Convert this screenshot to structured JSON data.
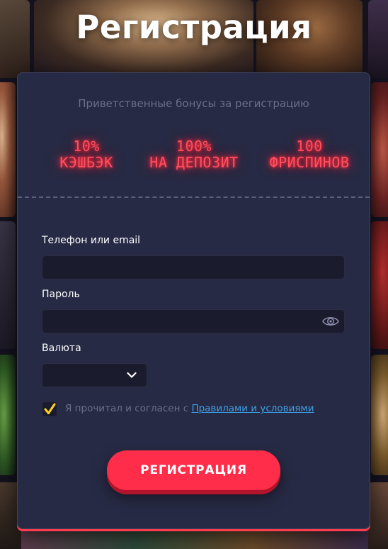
{
  "page": {
    "title": "Регистрация"
  },
  "bonuses": {
    "heading": "Приветственные бонусы за регистрацию",
    "items": [
      {
        "value": "10%",
        "label": "КЭШБЭК"
      },
      {
        "value": "100%",
        "label": "НА ДЕПОЗИТ"
      },
      {
        "value": "100",
        "label": "ФРИСПИНОВ"
      }
    ]
  },
  "form": {
    "login_label": "Телефон или email",
    "login_value": "",
    "password_label": "Пароль",
    "password_value": "",
    "currency_label": "Валюта",
    "currency_value": "",
    "terms_checked": true,
    "terms_text": "Я прочитал и согласен с ",
    "terms_link": "Правилами и условиями",
    "submit_label": "РЕГИСТРАЦИЯ"
  },
  "colors": {
    "accent": "#ff2d4a",
    "neon": "#ff5060",
    "card_bg": "#272a44",
    "input_bg": "#1b1b2e",
    "link": "#3d9fe6",
    "checkmark": "#ffd21e"
  },
  "icons": {
    "password_toggle": "eye-icon",
    "select_arrow": "chevron-down-icon",
    "checkbox": "checkmark-icon"
  }
}
